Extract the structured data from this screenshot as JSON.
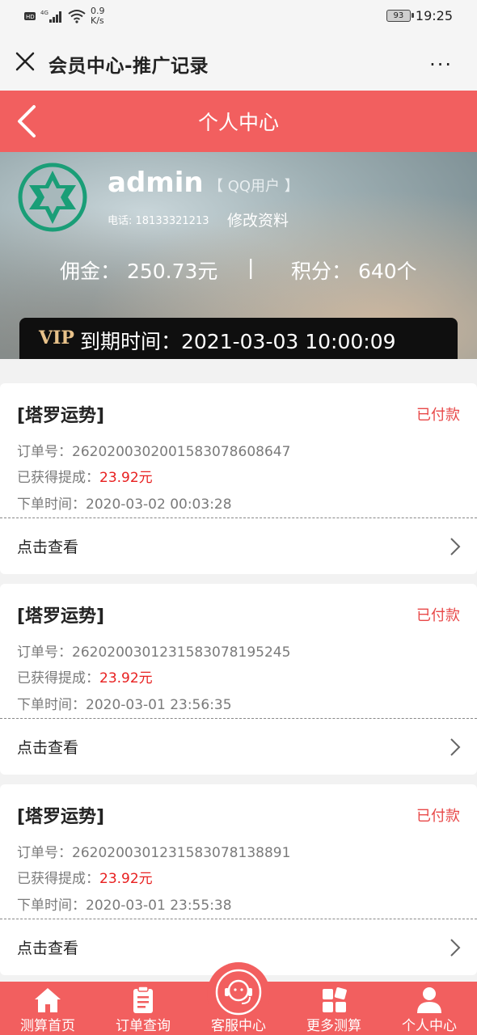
{
  "status_bar": {
    "network": "4G",
    "speed_value": "0.9",
    "speed_unit": "K/s",
    "battery": "93",
    "time": "19:25"
  },
  "titlebar": {
    "title": "会员中心-推广记录",
    "more": "···"
  },
  "header": {
    "title": "个人中心"
  },
  "profile": {
    "username": "admin",
    "user_type": "【 QQ用户 】",
    "phone": "电话: 18133321213",
    "edit_label": "修改资料",
    "commission": "佣金：  250.73元",
    "separator": "|",
    "points": "积分：  640个",
    "vip_label": "VIP",
    "expire": "到期时间：2021-03-03 10:00:09"
  },
  "orders": [
    {
      "title": "[塔罗运势]",
      "status": "已付款",
      "order_no_label": "订单号：",
      "order_no": "26202003020015830786086​47",
      "earned_label": "已获得提成：",
      "earned": "23.92元",
      "time_label": "下单时间：",
      "time": "2020-03-02 00:03:28",
      "view": "点击查看"
    },
    {
      "title": "[塔罗运势]",
      "status": "已付款",
      "order_no_label": "订单号：",
      "order_no": "262020030123158307819524​5",
      "earned_label": "已获得提成：",
      "earned": "23.92元",
      "time_label": "下单时间：",
      "time": "2020-03-01 23:56:35",
      "view": "点击查看"
    },
    {
      "title": "[塔罗运势]",
      "status": "已付款",
      "order_no_label": "订单号：",
      "order_no": "262020030123158307813889​1",
      "earned_label": "已获得提成：",
      "earned": "23.92元",
      "time_label": "下单时间：",
      "time": "2020-03-01 23:55:38",
      "view": "点击查看"
    }
  ],
  "tabs": [
    {
      "label": "测算首页",
      "icon": "home-icon"
    },
    {
      "label": "订单查询",
      "icon": "clipboard-icon"
    },
    {
      "label": "客服中心",
      "icon": "customer-service-icon"
    },
    {
      "label": "更多测算",
      "icon": "grid-icon"
    },
    {
      "label": "个人中心",
      "icon": "user-icon"
    }
  ],
  "colors": {
    "accent": "#f25f5f",
    "status": "#e84848",
    "amount": "#e82020",
    "avatar": "#1a9e77"
  }
}
